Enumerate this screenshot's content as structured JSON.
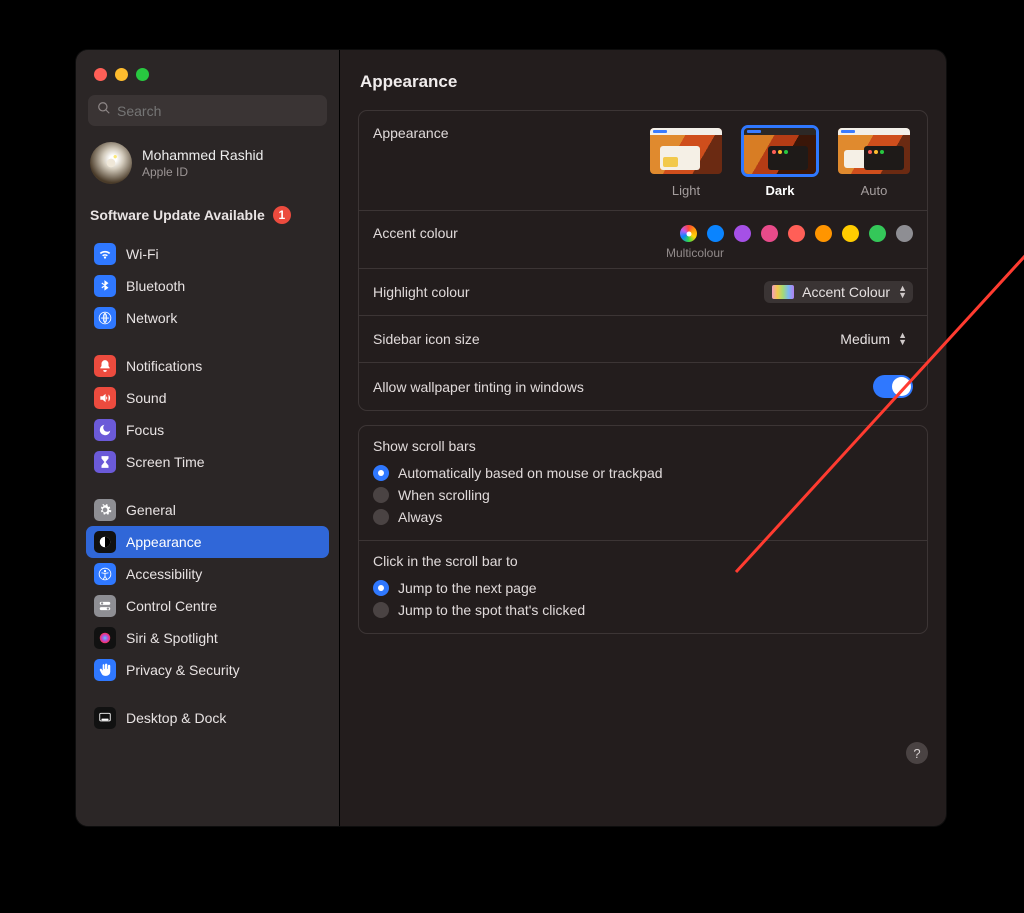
{
  "window": {
    "title": "Appearance",
    "search_placeholder": "Search"
  },
  "user": {
    "name": "Mohammed Rashid",
    "sub": "Apple ID"
  },
  "update": {
    "label": "Software Update Available",
    "badge": "1"
  },
  "sidebar": {
    "groups": [
      {
        "items": [
          {
            "id": "wifi",
            "label": "Wi-Fi",
            "icon_bg": "#2f78ff",
            "glyph": "wifi"
          },
          {
            "id": "bluetooth",
            "label": "Bluetooth",
            "icon_bg": "#2f78ff",
            "glyph": "bt"
          },
          {
            "id": "network",
            "label": "Network",
            "icon_bg": "#2f78ff",
            "glyph": "globe"
          }
        ]
      },
      {
        "items": [
          {
            "id": "notifications",
            "label": "Notifications",
            "icon_bg": "#ec4b3e",
            "glyph": "bell"
          },
          {
            "id": "sound",
            "label": "Sound",
            "icon_bg": "#ec4b3e",
            "glyph": "sound"
          },
          {
            "id": "focus",
            "label": "Focus",
            "icon_bg": "#6b5ad8",
            "glyph": "moon"
          },
          {
            "id": "screentime",
            "label": "Screen Time",
            "icon_bg": "#6b5ad8",
            "glyph": "hourglass"
          }
        ]
      },
      {
        "items": [
          {
            "id": "general",
            "label": "General",
            "icon_bg": "#8e8e93",
            "glyph": "gear"
          },
          {
            "id": "appearance",
            "label": "Appearance",
            "icon_bg": "#111",
            "glyph": "appearance",
            "selected": true
          },
          {
            "id": "accessibility",
            "label": "Accessibility",
            "icon_bg": "#2f78ff",
            "glyph": "a11y"
          },
          {
            "id": "controlcentre",
            "label": "Control Centre",
            "icon_bg": "#8e8e93",
            "glyph": "switches"
          },
          {
            "id": "siri",
            "label": "Siri & Spotlight",
            "icon_bg": "#111",
            "glyph": "siri"
          },
          {
            "id": "privacy",
            "label": "Privacy & Security",
            "icon_bg": "#2f78ff",
            "glyph": "hand"
          }
        ]
      },
      {
        "items": [
          {
            "id": "desktop",
            "label": "Desktop & Dock",
            "icon_bg": "#111",
            "glyph": "dock"
          }
        ]
      }
    ]
  },
  "appearance": {
    "section_label": "Appearance",
    "themes": [
      {
        "id": "light",
        "label": "Light"
      },
      {
        "id": "dark",
        "label": "Dark",
        "selected": true
      },
      {
        "id": "auto",
        "label": "Auto"
      }
    ],
    "accent_label": "Accent colour",
    "accent_sublabel": "Multicolour",
    "accents": [
      {
        "id": "multicolour",
        "selected": true
      },
      {
        "id": "blue",
        "color": "#0a84ff"
      },
      {
        "id": "purple",
        "color": "#a550e6"
      },
      {
        "id": "pink",
        "color": "#e84b8a"
      },
      {
        "id": "red",
        "color": "#ff5f57"
      },
      {
        "id": "orange",
        "color": "#ff9500"
      },
      {
        "id": "yellow",
        "color": "#ffcc00"
      },
      {
        "id": "green",
        "color": "#34c759"
      },
      {
        "id": "graphite",
        "color": "#8e8e93"
      }
    ],
    "highlight_label": "Highlight colour",
    "highlight_value": "Accent Colour",
    "sidebar_size_label": "Sidebar icon size",
    "sidebar_size_value": "Medium",
    "wallpaper_tint_label": "Allow wallpaper tinting in windows",
    "wallpaper_tint_on": true
  },
  "scrollbars": {
    "title": "Show scroll bars",
    "options": [
      {
        "label": "Automatically based on mouse or trackpad",
        "checked": true
      },
      {
        "label": "When scrolling"
      },
      {
        "label": "Always"
      }
    ],
    "click_title": "Click in the scroll bar to",
    "click_options": [
      {
        "label": "Jump to the next page",
        "checked": true
      },
      {
        "label": "Jump to the spot that's clicked"
      }
    ]
  },
  "help_tooltip": "?"
}
